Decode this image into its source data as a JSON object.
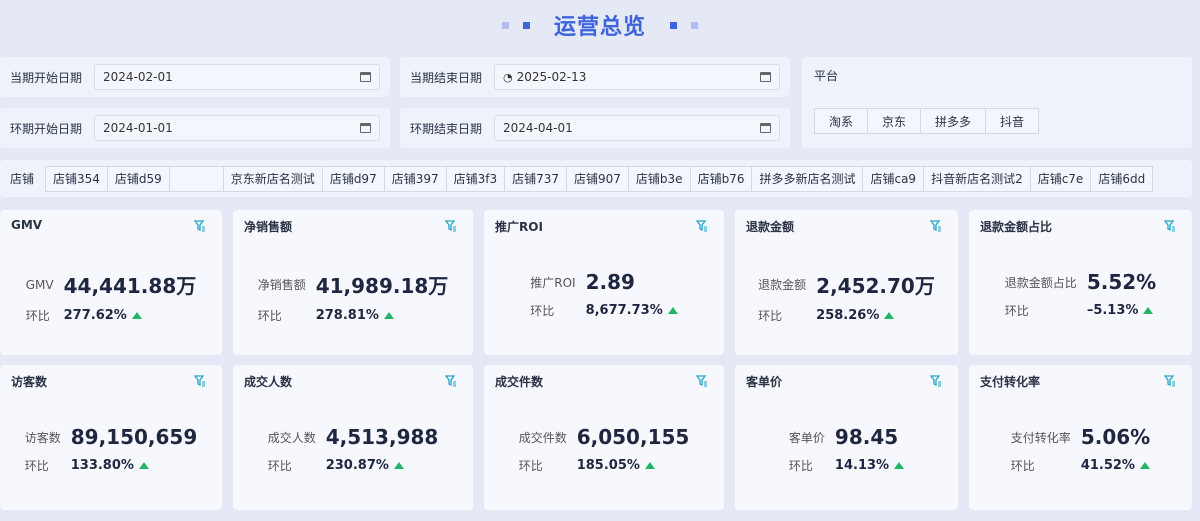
{
  "title": "运营总览",
  "filters": {
    "cur_start": {
      "label": "当期开始日期",
      "value": "2024-02-01"
    },
    "cur_end": {
      "label": "当期结束日期",
      "value": "2025-02-13"
    },
    "prev_start": {
      "label": "环期开始日期",
      "value": "2024-01-01"
    },
    "prev_end": {
      "label": "环期结束日期",
      "value": "2024-04-01"
    }
  },
  "platform": {
    "label": "平台",
    "options": [
      "淘系",
      "京东",
      "拼多多",
      "抖音"
    ]
  },
  "stores": {
    "label": "店铺",
    "items": [
      "店铺354",
      "店铺d59",
      "",
      "京东新店名测试",
      "店铺d97",
      "店铺397",
      "店铺3f3",
      "店铺737",
      "店铺907",
      "店铺b3e",
      "店铺b76",
      "拼多多新店名测试",
      "店铺ca9",
      "抖音新店名测试2",
      "店铺c7e",
      "店铺6dd"
    ]
  },
  "cards": [
    {
      "title": "GMV",
      "label": "GMV",
      "value": "44,441.88万",
      "chg_label": "环比",
      "chg": "277.62%",
      "trend": "up"
    },
    {
      "title": "净销售额",
      "label": "净销售额",
      "value": "41,989.18万",
      "chg_label": "环比",
      "chg": "278.81%",
      "trend": "up"
    },
    {
      "title": "推广ROI",
      "label": "推广ROI",
      "value": "2.89",
      "chg_label": "环比",
      "chg": "8,677.73%",
      "trend": "up"
    },
    {
      "title": "退款金额",
      "label": "退款金额",
      "value": "2,452.70万",
      "chg_label": "环比",
      "chg": "258.26%",
      "trend": "up"
    },
    {
      "title": "退款金额占比",
      "label": "退款金额占比",
      "value": "5.52%",
      "chg_label": "环比",
      "chg": "–5.13%",
      "trend": "up"
    },
    {
      "title": "访客数",
      "label": "访客数",
      "value": "89,150,659",
      "chg_label": "环比",
      "chg": "133.80%",
      "trend": "up"
    },
    {
      "title": "成交人数",
      "label": "成交人数",
      "value": "4,513,988",
      "chg_label": "环比",
      "chg": "230.87%",
      "trend": "up"
    },
    {
      "title": "成交件数",
      "label": "成交件数",
      "value": "6,050,155",
      "chg_label": "环比",
      "chg": "185.05%",
      "trend": "up"
    },
    {
      "title": "客单价",
      "label": "客单价",
      "value": "98.45",
      "chg_label": "环比",
      "chg": "14.13%",
      "trend": "up"
    },
    {
      "title": "支付转化率",
      "label": "支付转化率",
      "value": "5.06%",
      "chg_label": "环比",
      "chg": "41.52%",
      "trend": "up"
    }
  ],
  "colors": {
    "accent": "#3d63dd",
    "up": "#23b46a",
    "filter_icon": "#22a6c8"
  }
}
